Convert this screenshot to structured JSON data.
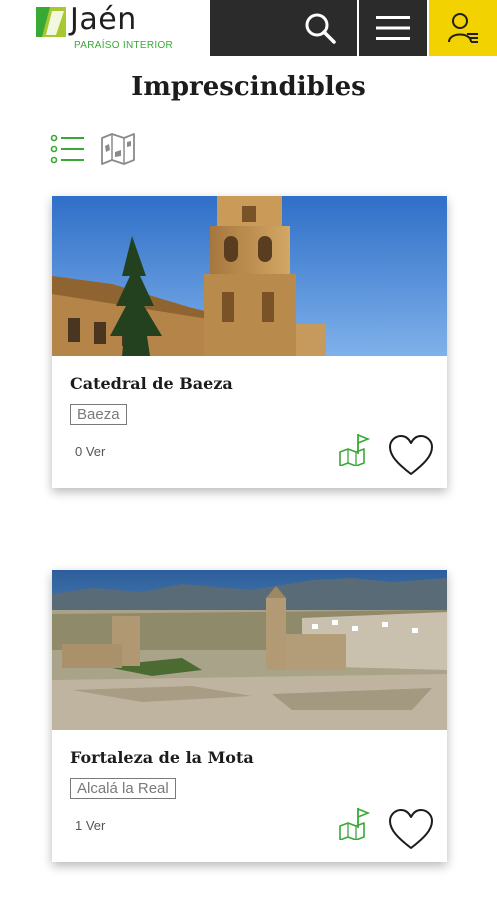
{
  "header": {
    "logo_name": "Jaén",
    "logo_tagline": "PARAÍSO INTERIOR",
    "icons": [
      "search-icon",
      "menu-icon",
      "user-icon"
    ]
  },
  "page": {
    "title": "Imprescindibles"
  },
  "view_toggle": {
    "icons": [
      "list-view-icon",
      "map-view-icon"
    ]
  },
  "cards": [
    {
      "title": "Catedral de Baeza",
      "location": "Baeza",
      "views": "0 Ver"
    },
    {
      "title": "Fortaleza de la Mota",
      "location": "Alcalá la Real",
      "views": "1 Ver"
    }
  ],
  "colors": {
    "brand_green": "#39a935",
    "brand_yellow": "#f2d200",
    "header_dark": "#2b2b2b"
  }
}
